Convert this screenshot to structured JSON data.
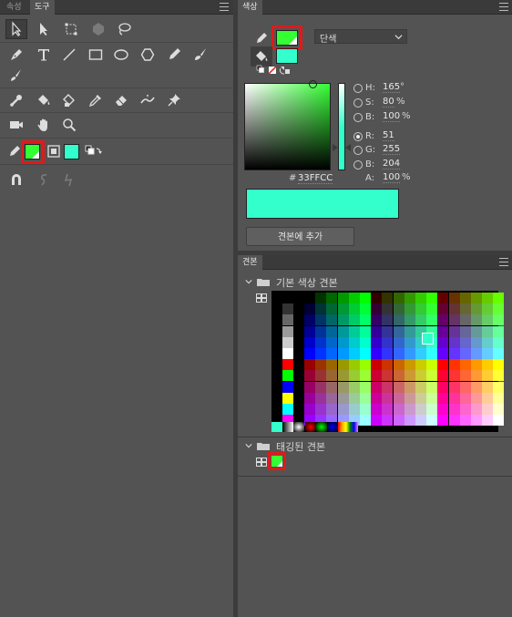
{
  "tools_panel": {
    "tabs": [
      "속성",
      "도구"
    ],
    "fill_color": "#33FFCC",
    "stroke_color": "#33FF33"
  },
  "color_panel": {
    "tab": "색상",
    "fill_type": "단색",
    "hsb": {
      "h_label": "H:",
      "h_value": "165",
      "h_unit": "°",
      "s_label": "S:",
      "s_value": "80",
      "s_unit": "%",
      "b_label": "B:",
      "b_value": "100",
      "b_unit": "%"
    },
    "rgb": {
      "r_label": "R:",
      "r_value": "51",
      "g_label": "G:",
      "g_value": "255",
      "b_label": "B:",
      "b_value": "204",
      "a_label": "A:",
      "a_value": "100",
      "a_unit": "%"
    },
    "hex_label": "#",
    "hex_value": "33FFCC",
    "current_color": "#33FFCC",
    "add_swatch_button": "견본에 추가"
  },
  "swatches_panel": {
    "tab": "견본",
    "group_default": "기본 색상 견본",
    "group_tagged": "태깅된 견본",
    "tagged_color": "#33FF33"
  }
}
